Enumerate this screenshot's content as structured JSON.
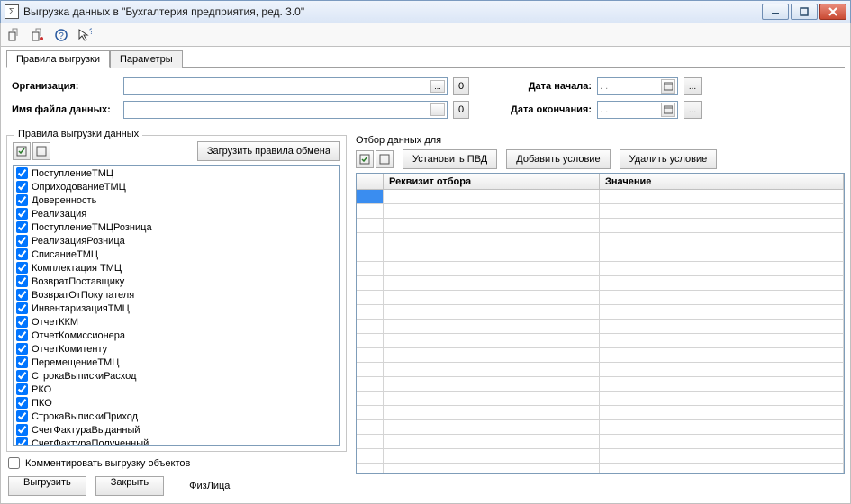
{
  "window": {
    "title": "Выгрузка данных в \"Бухгалтерия предприятия, ред. 3.0\""
  },
  "tabs": [
    {
      "label": "Правила выгрузки",
      "active": true
    },
    {
      "label": "Параметры",
      "active": false
    }
  ],
  "form": {
    "org_label": "Организация:",
    "org_value": "",
    "file_label": "Имя файла данных:",
    "file_value": "",
    "zero_btn": "0",
    "date_start_label": "Дата начала:",
    "date_start_value": " .  .  ",
    "date_end_label": "Дата окончания:",
    "date_end_value": " .  .  ",
    "dots": "...",
    "calendar_icon": "🗓"
  },
  "rules_group": {
    "title": "Правила выгрузки данных",
    "load_rules_label": "Загрузить правила обмена",
    "items": [
      "ПоступлениеТМЦ",
      "ОприходованиеТМЦ",
      "Доверенность",
      "Реализация",
      "ПоступлениеТМЦРозница",
      "РеализацияРозница",
      "СписаниеТМЦ",
      "Комплектация ТМЦ",
      "ВозвратПоставщику",
      "ВозвратОтПокупателя",
      "ИнвентаризацияТМЦ",
      "ОтчетККМ",
      "ОтчетКомиссионера",
      "ОтчетКомитенту",
      "ПеремещениеТМЦ",
      "СтрокаВыпискиРасход",
      "РКО",
      "ПКО",
      "СтрокаВыпискиПриход",
      "СчетФактураВыданный",
      "СчетФактураПолученный"
    ]
  },
  "filter_group": {
    "title": "Отбор данных для",
    "set_pvd": "Установить ПВД",
    "add_cond": "Добавить условие",
    "del_cond": "Удалить условие",
    "col_req": "Реквизит отбора",
    "col_val": "Значение",
    "row_count": 20
  },
  "bottom": {
    "comment_label": "Комментировать выгрузку объектов",
    "export_btn": "Выгрузить",
    "close_btn": "Закрыть",
    "status": "ФизЛица"
  }
}
